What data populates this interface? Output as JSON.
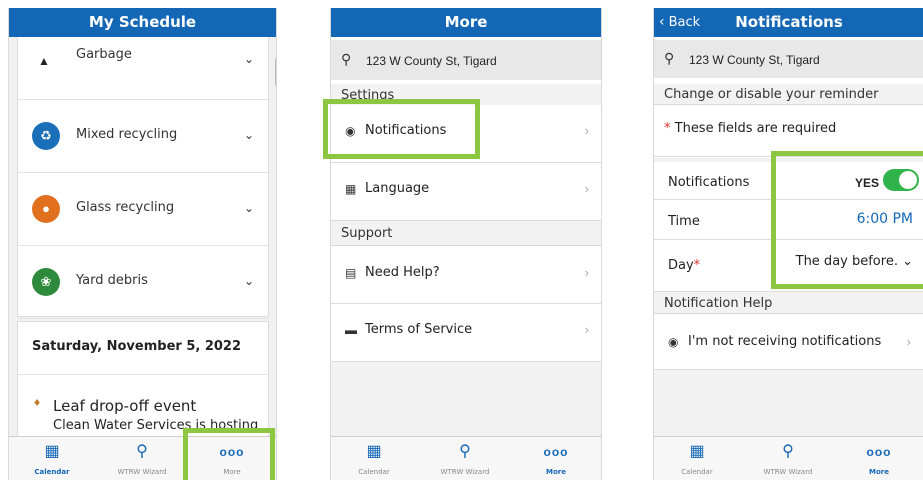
{
  "screen1": {
    "title": "My Schedule",
    "items": [
      {
        "label": "Garbage",
        "icon": "garbage-icon"
      },
      {
        "label": "Mixed recycling",
        "icon": "recycle-icon",
        "color": "#1b6eb8"
      },
      {
        "label": "Glass recycling",
        "icon": "glass-icon",
        "color": "#e0701d"
      },
      {
        "label": "Yard debris",
        "icon": "leaf-icon",
        "color": "#2e8b3d"
      }
    ],
    "event_date": "Saturday, November 5, 2022",
    "event_title": "Leaf drop-off event",
    "event_host": "Clean Water Services is hosting"
  },
  "screen2": {
    "title": "More",
    "address": "123 W County St, Tigard",
    "settings_header": "Settings",
    "notifications": "Notifications",
    "language": "Language",
    "support_header": "Support",
    "need_help": "Need Help?",
    "terms": "Terms of Service"
  },
  "screen3": {
    "back": "Back",
    "title": "Notifications",
    "address": "123 W County St, Tigard",
    "change_header": "Change or disable your reminder",
    "required_star": "*",
    "required_text": " These fields are required",
    "notifications_label": "Notifications",
    "notifications_value": "YES",
    "time_label": "Time",
    "time_value": "6:00 PM",
    "day_label": "Day",
    "day_star": "*",
    "day_value": "The day before.",
    "help_header": "Notification Help",
    "help_item": "I'm not receiving notifications"
  },
  "tabs": {
    "calendar": "Calendar",
    "wizard": "WTRW Wizard",
    "more": "More"
  },
  "colors": {
    "header": "#1467b5",
    "highlight": "#8dc63f",
    "toggle_on": "#2fb34a"
  }
}
